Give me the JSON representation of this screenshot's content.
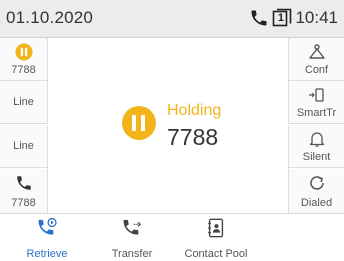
{
  "status_bar": {
    "date": "01.10.2020",
    "line_number": "1",
    "time": "10:41"
  },
  "left_keys": [
    {
      "label": "7788",
      "icon": "hold-badge-icon"
    },
    {
      "label": "Line"
    },
    {
      "label": "Line"
    },
    {
      "label": "7788",
      "icon": "phone-icon"
    }
  ],
  "right_keys": [
    {
      "label": "Conf",
      "icon": "conference-icon"
    },
    {
      "label": "SmartTr",
      "icon": "smart-transfer-icon"
    },
    {
      "label": "Silent",
      "icon": "bell-icon"
    },
    {
      "label": "Dialed",
      "icon": "redial-icon"
    }
  ],
  "call": {
    "status": "Holding",
    "number": "7788"
  },
  "softkeys": [
    {
      "label": "Retrieve",
      "icon": "retrieve-icon"
    },
    {
      "label": "Transfer",
      "icon": "transfer-icon"
    },
    {
      "label": "Contact Pool",
      "icon": "contact-pool-icon"
    }
  ],
  "colors": {
    "hold_accent": "#f2b31b",
    "active_blue": "#2a6fc9",
    "status_bar_bg": "#ececec"
  }
}
